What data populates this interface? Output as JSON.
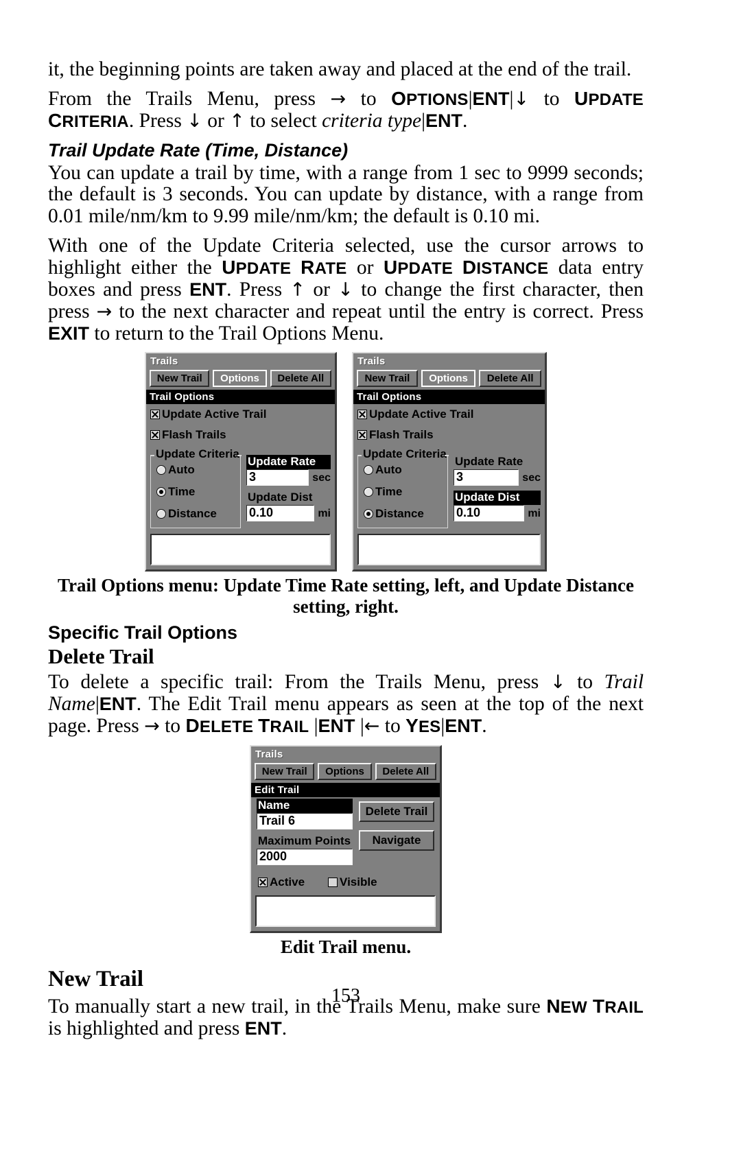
{
  "page": {
    "number": "153"
  },
  "paragraphs": {
    "p1": "it, the beginning points are taken away and placed at the end of the trail.",
    "p2_a": "From the Trails Menu, press",
    "p2_b": "to",
    "p2_options": "Options",
    "p2_ent": "ENT",
    "p2_c": "to",
    "p2_update_criteria": "Update Criteria",
    "p2_d": "Press",
    "p2_e": "or",
    "p2_f": "to select",
    "p2_criteria_type": "criteria type",
    "p2_ent2": "ENT",
    "p3": "You can update a trail by time, with a range from 1 sec to 9999 seconds; the default is 3 seconds. You can update by distance, with a range from 0.01 mile/nm/km to 9.99 mile/nm/km; the default is 0.10 mi.",
    "p4_a": "With one of the Update Criteria selected, use the cursor arrows to highlight either the",
    "p4_update_rate": "Update Rate",
    "p4_or": "or",
    "p4_update_distance": "Update Distance",
    "p4_b": "data entry boxes and press",
    "p4_ent": "ENT",
    "p4_c": ". Press",
    "p4_d": "or",
    "p4_e": "to change the first character, then press",
    "p4_f": "to the next character and repeat until the entry is correct. Press",
    "p4_exit": "EXIT",
    "p4_g": "to return to the Trail Options Menu.",
    "p5_a": "To delete a specific trail: From the Trails Menu, press",
    "p5_b": "to",
    "p5_trail_name": "Trail Name",
    "p5_ent": "ENT",
    "p5_c": ". The Edit Trail menu appears as seen at the top of the next page. Press",
    "p5_d": "to",
    "p5_delete_trail": "Delete Trail",
    "p5_ent2": "ENT",
    "p5_e": "to",
    "p5_yes": "Yes",
    "p5_ent3": "ENT",
    "p6_a": "To manually start a new trail, in the Trails Menu, make sure",
    "p6_new_trail": "New Trail",
    "p6_b": "is highlighted and press",
    "p6_ent": "ENT"
  },
  "headings": {
    "trail_update_rate": "Trail Update Rate (Time, Distance)",
    "specific_trail_options": "Specific Trail Options",
    "delete_trail": "Delete Trail",
    "new_trail": "New Trail"
  },
  "captions": {
    "fig1": "Trail Options menu: Update Time Rate setting, left, and Update Distance setting, right.",
    "fig2": "Edit Trail menu."
  },
  "gps_screens": {
    "trail_options_time": {
      "window_title": "Trails",
      "tabs": [
        {
          "label": "New Trail",
          "selected": false
        },
        {
          "label": "Options",
          "selected": true
        },
        {
          "label": "Delete All",
          "selected": false
        }
      ],
      "panel_title": "Trail Options",
      "checkboxes": [
        {
          "label": "Update Active Trail",
          "checked": true
        },
        {
          "label": "Flash Trails",
          "checked": true
        }
      ],
      "group_label": "Update Criteria",
      "radios": [
        {
          "label": "Auto",
          "selected": false
        },
        {
          "label": "Time",
          "selected": true
        },
        {
          "label": "Distance",
          "selected": false
        }
      ],
      "fields": [
        {
          "label": "Update Rate",
          "highlighted": true,
          "value": "3",
          "unit": "sec"
        },
        {
          "label": "Update Dist",
          "highlighted": false,
          "value": "0.10",
          "unit": "mi"
        }
      ]
    },
    "trail_options_distance": {
      "window_title": "Trails",
      "tabs": [
        {
          "label": "New Trail",
          "selected": false
        },
        {
          "label": "Options",
          "selected": true
        },
        {
          "label": "Delete All",
          "selected": false
        }
      ],
      "panel_title": "Trail Options",
      "checkboxes": [
        {
          "label": "Update Active Trail",
          "checked": true
        },
        {
          "label": "Flash Trails",
          "checked": true
        }
      ],
      "group_label": "Update Criteria",
      "radios": [
        {
          "label": "Auto",
          "selected": false
        },
        {
          "label": "Time",
          "selected": false
        },
        {
          "label": "Distance",
          "selected": true
        }
      ],
      "fields": [
        {
          "label": "Update Rate",
          "highlighted": false,
          "value": "3",
          "unit": "sec"
        },
        {
          "label": "Update Dist",
          "highlighted": true,
          "value": "0.10",
          "unit": "mi"
        }
      ]
    },
    "edit_trail": {
      "window_title": "Trails",
      "tabs": [
        {
          "label": "New Trail",
          "selected": false
        },
        {
          "label": "Options",
          "selected": false
        },
        {
          "label": "Delete All",
          "selected": false
        }
      ],
      "panel_title": "Edit Trail",
      "name_label": "Name",
      "name_value": "Trail 6",
      "max_points_label": "Maximum Points",
      "max_points_value": "2000",
      "buttons": [
        {
          "label": "Delete Trail"
        },
        {
          "label": "Navigate"
        }
      ],
      "checkboxes": [
        {
          "label": "Active",
          "checked": true
        },
        {
          "label": "Visible",
          "checked": false
        }
      ]
    }
  },
  "glyphs": {
    "right_arrow": "→",
    "left_arrow": "←",
    "up_arrow": "↑",
    "down_arrow": "↓",
    "pipe": "|"
  }
}
